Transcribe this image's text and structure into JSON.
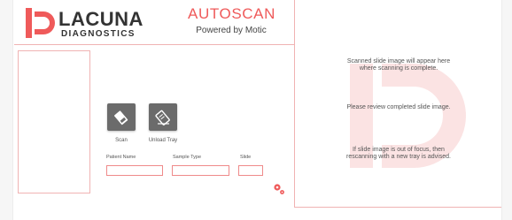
{
  "brand": {
    "name": "LACUNA",
    "subtitle": "DIAGNOSTICS",
    "logo_icon": "lacuna-ld-logo-icon",
    "accent_color": "#ef5a5a"
  },
  "app": {
    "title": "AUTOSCAN",
    "subtitle": "Powered by Motic"
  },
  "toolbar": {
    "scan_label": "Scan",
    "scan_icon": "scan-slide-icon",
    "unload_label": "Unload Tray",
    "unload_icon": "unload-tray-icon"
  },
  "form": {
    "patient_name_label": "Patient Name",
    "patient_name_value": "",
    "sample_type_label": "Sample Type",
    "sample_type_value": "",
    "slide_label": "Slide",
    "slide_value": ""
  },
  "settings_icon": "settings-icon",
  "viewer": {
    "line1": "Scanned slide image will appear here",
    "line2": "where scanning is complete.",
    "review_text": "Please review completed slide image.",
    "focus_line1": "If slide image is out of focus, then",
    "focus_line2": "rescanning with a new tray is advised."
  }
}
